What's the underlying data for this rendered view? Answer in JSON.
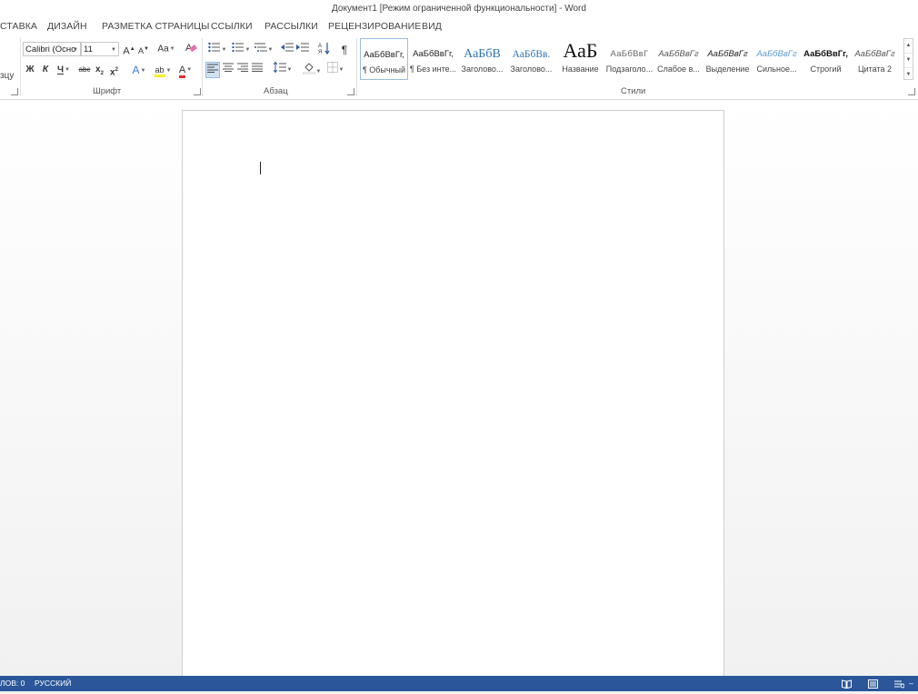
{
  "window": {
    "title": "Документ1 [Режим ограниченной функциональности] - Word"
  },
  "tabs": [
    "СТАВКА",
    "ДИЗАЙН",
    "РАЗМЕТКА СТРАНИЦЫ",
    "ССЫЛКИ",
    "РАССЫЛКИ",
    "РЕЦЕНЗИРОВАНИЕ",
    "ВИД"
  ],
  "clipboard": {
    "partial_label": "зцу"
  },
  "font": {
    "group_label": "Шрифт",
    "font_name": "Calibri (Осно",
    "font_size": "11",
    "grow": "A",
    "shrink": "A",
    "change_case": "Aa",
    "bold": "Ж",
    "italic": "К",
    "underline": "Ч",
    "strike": "abc",
    "subscript": "x",
    "superscript": "x",
    "sub_mark": "2",
    "sup_mark": "2",
    "effects": "A",
    "font_color_label": "A",
    "highlight_label": "ab",
    "colors": {
      "font_color": "#e8282a",
      "highlight": "#f5ef2c"
    }
  },
  "paragraph": {
    "group_label": "Абзац",
    "pilcrow": "¶"
  },
  "styles": {
    "group_label": "Стили",
    "items": [
      {
        "sample": "АаБбВвГг,",
        "name": "¶ Обычный",
        "active": true
      },
      {
        "sample": "АаБбВвГг,",
        "name": "¶ Без инте..."
      },
      {
        "sample": "АаБбВ",
        "name": "Заголово..."
      },
      {
        "sample": "АаБбВв.",
        "name": "Заголово..."
      },
      {
        "sample": "АаБ",
        "name": "Название"
      },
      {
        "sample": "АаБбВвГ",
        "name": "Подзаголо..."
      },
      {
        "sample": "АаБбВвГг",
        "name": "Слабое в..."
      },
      {
        "sample": "АаБбВвГг",
        "name": "Выделение"
      },
      {
        "sample": "АаБбВвГг",
        "name": "Сильное..."
      },
      {
        "sample": "АаБбВвГг,",
        "name": "Строгий"
      },
      {
        "sample": "АаБбВвГг",
        "name": "Цитата 2"
      }
    ]
  },
  "statusbar": {
    "words": "ЛОВ: 0",
    "language": "РУССКИЙ",
    "background_color": "#2b579a"
  }
}
